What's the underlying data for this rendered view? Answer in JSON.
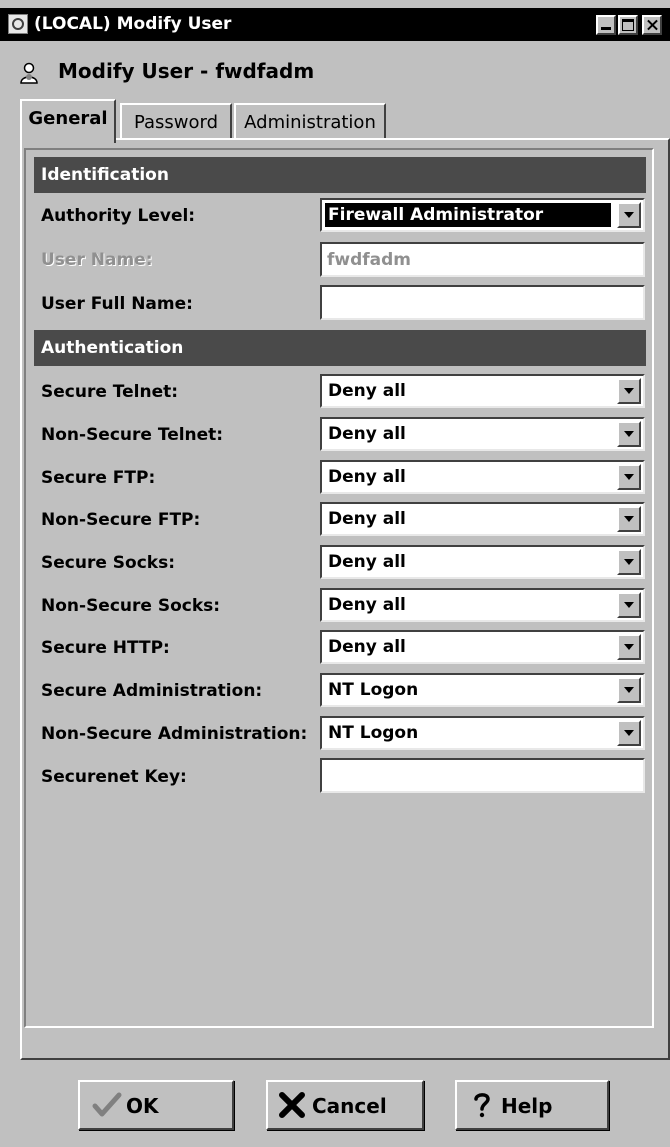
{
  "window": {
    "title": "(LOCAL) Modify User"
  },
  "heading": {
    "text": "Modify User - fwdfadm"
  },
  "tabs": [
    {
      "label": "General",
      "selected": true
    },
    {
      "label": "Password",
      "selected": false
    },
    {
      "label": "Administration",
      "selected": false
    }
  ],
  "identification": {
    "header": "Identification",
    "authority_level": {
      "label": "Authority Level:",
      "value": "Firewall Administrator"
    },
    "user_name": {
      "label": "User Name:",
      "value": "fwdfadm"
    },
    "user_full_name": {
      "label": "User Full Name:",
      "value": ""
    }
  },
  "authentication": {
    "header": "Authentication",
    "rows": [
      {
        "label": "Secure Telnet:",
        "value": "Deny all"
      },
      {
        "label": "Non-Secure Telnet:",
        "value": "Deny all"
      },
      {
        "label": "Secure FTP:",
        "value": "Deny all"
      },
      {
        "label": "Non-Secure FTP:",
        "value": "Deny all"
      },
      {
        "label": "Secure Socks:",
        "value": "Deny all"
      },
      {
        "label": "Non-Secure Socks:",
        "value": "Deny all"
      },
      {
        "label": "Secure HTTP:",
        "value": "Deny all"
      },
      {
        "label": "Secure Administration:",
        "value": "NT Logon"
      },
      {
        "label": "Non-Secure Administration:",
        "value": "NT Logon"
      }
    ],
    "securenet_key": {
      "label": "Securenet Key:",
      "value": ""
    }
  },
  "buttons": {
    "ok": "OK",
    "cancel": "Cancel",
    "help": "Help"
  },
  "icons": {
    "app": "app-window-icon",
    "user": "user-icon",
    "ok": "checkmark-icon",
    "cancel": "x-icon",
    "help": "question-mark-icon"
  }
}
